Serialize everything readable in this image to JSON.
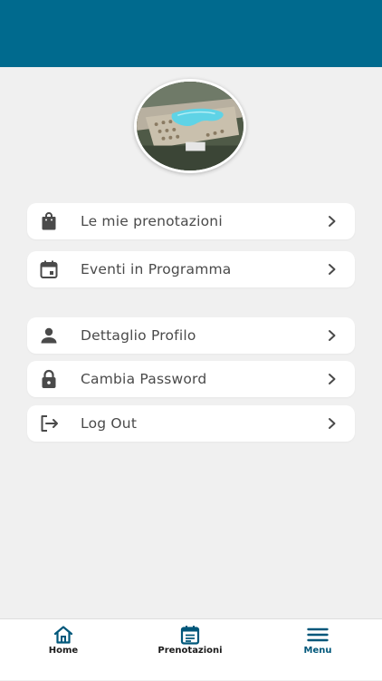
{
  "colors": {
    "header": "#006a8e",
    "background": "#f0f0f0",
    "icon": "#4a4a4a",
    "tab_icon": "#00577a"
  },
  "menu_groups": [
    [
      {
        "label": "Le mie prenotazioni",
        "icon": "shopping-bag-icon"
      },
      {
        "label": "Eventi in Programma",
        "icon": "calendar-icon"
      }
    ],
    [
      {
        "label": "Dettaglio Profilo",
        "icon": "person-icon"
      },
      {
        "label": "Cambia Password",
        "icon": "lock-icon"
      },
      {
        "label": "Log Out",
        "icon": "logout-icon"
      }
    ]
  ],
  "tabbar": {
    "tabs": [
      {
        "label": "Home",
        "icon": "home-icon",
        "active": false
      },
      {
        "label": "Prenotazioni",
        "icon": "calendar-list-icon",
        "active": false
      },
      {
        "label": "Menu",
        "icon": "hamburger-menu-icon",
        "active": true
      }
    ]
  }
}
